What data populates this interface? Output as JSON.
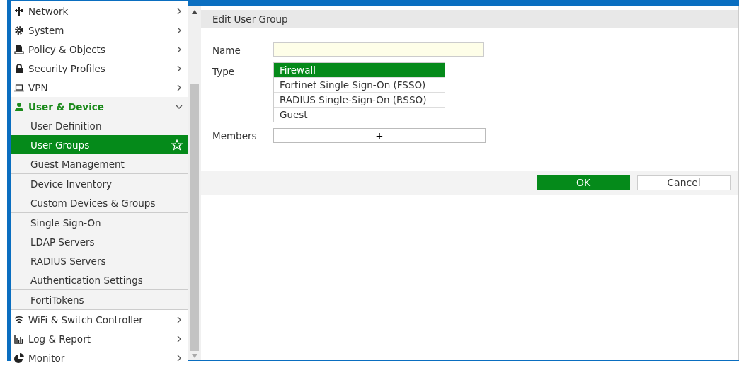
{
  "sidebar": {
    "items": [
      {
        "label": "Network",
        "expanded": false
      },
      {
        "label": "System",
        "expanded": false
      },
      {
        "label": "Policy & Objects",
        "expanded": false
      },
      {
        "label": "Security Profiles",
        "expanded": false
      },
      {
        "label": "VPN",
        "expanded": false
      },
      {
        "label": "User & Device",
        "expanded": true,
        "children": [
          {
            "items": [
              {
                "label": "User Definition",
                "selected": false
              },
              {
                "label": "User Groups",
                "selected": true
              },
              {
                "label": "Guest Management",
                "selected": false
              }
            ]
          },
          {
            "items": [
              {
                "label": "Device Inventory",
                "selected": false
              },
              {
                "label": "Custom Devices & Groups",
                "selected": false
              }
            ]
          },
          {
            "items": [
              {
                "label": "Single Sign-On",
                "selected": false
              },
              {
                "label": "LDAP Servers",
                "selected": false
              },
              {
                "label": "RADIUS Servers",
                "selected": false
              },
              {
                "label": "Authentication Settings",
                "selected": false
              }
            ]
          },
          {
            "items": [
              {
                "label": "FortiTokens",
                "selected": false
              }
            ]
          }
        ]
      },
      {
        "label": "WiFi & Switch Controller",
        "expanded": false
      },
      {
        "label": "Log & Report",
        "expanded": false
      },
      {
        "label": "Monitor",
        "expanded": false
      }
    ]
  },
  "panel": {
    "title": "Edit User Group",
    "fields": [
      {
        "kind": "text",
        "label": "Name"
      },
      {
        "kind": "list",
        "label": "Type",
        "options": [
          {
            "label": "Firewall",
            "selected": true
          },
          {
            "label": "Fortinet Single Sign-On (FSSO)",
            "selected": false
          },
          {
            "label": "RADIUS Single-Sign-On (RSSO)",
            "selected": false
          },
          {
            "label": "Guest",
            "selected": false
          }
        ]
      },
      {
        "kind": "add",
        "label": "Members",
        "button": "+"
      }
    ],
    "buttons": [
      {
        "label": "OK",
        "kind": "primary"
      },
      {
        "label": "Cancel",
        "kind": "secondary"
      }
    ]
  }
}
